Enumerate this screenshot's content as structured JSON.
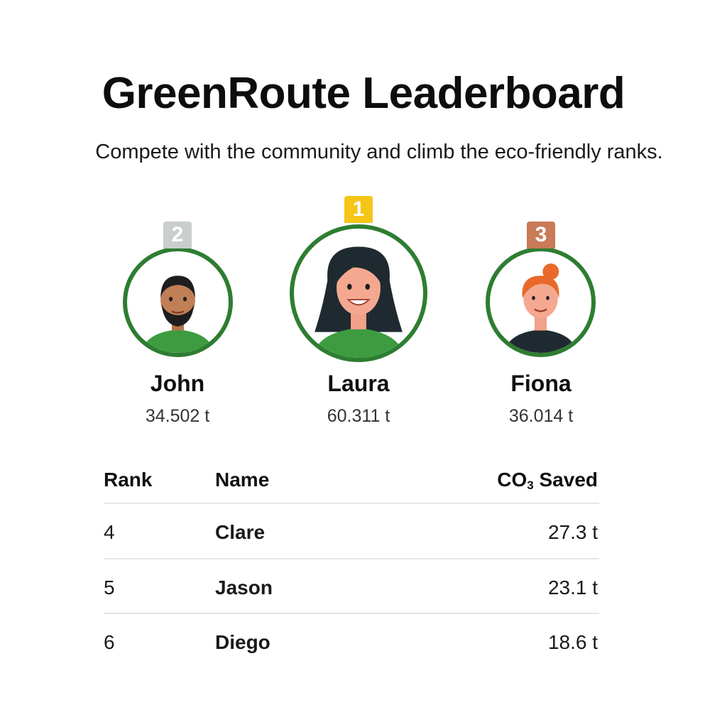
{
  "header": {
    "title": "GreenRoute Leaderboard",
    "subtitle": "Compete with the community and climb the eco-friendly ranks."
  },
  "podium": [
    {
      "rank": "2",
      "name": "John",
      "score": "34.502 t",
      "badge_color": "#c9cfcd"
    },
    {
      "rank": "1",
      "name": "Laura",
      "score": "60.311 t",
      "badge_color": "#f5c518"
    },
    {
      "rank": "3",
      "name": "Fiona",
      "score": "36.014 t",
      "badge_color": "#c97a57"
    }
  ],
  "table": {
    "headers": {
      "rank": "Rank",
      "name": "Name",
      "co2_prefix": "CO",
      "co2_sub": "3",
      "co2_suffix": " Saved"
    },
    "rows": [
      {
        "rank": "4",
        "name": "Clare",
        "value": "27.3 t"
      },
      {
        "rank": "5",
        "name": "Jason",
        "value": "23.1 t"
      },
      {
        "rank": "6",
        "name": "Diego",
        "value": "18.6 t"
      }
    ]
  },
  "colors": {
    "ring": "#2e7d32",
    "shirt_green": "#3d9c3f",
    "divider": "#e3e6e4"
  }
}
